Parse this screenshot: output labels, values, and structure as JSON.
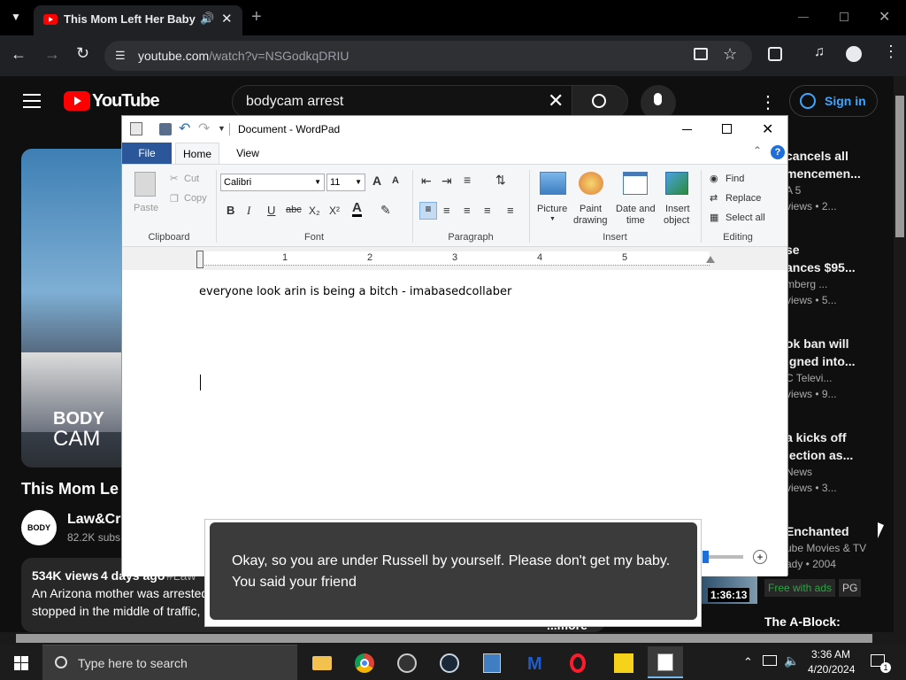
{
  "browser": {
    "tab_title": "This Mom Left Her Baby H",
    "url_host": "youtube.com",
    "url_path": "/watch?v=NSGodkqDRIU"
  },
  "youtube": {
    "logo_text": "YouTube",
    "search_value": "bodycam arrest",
    "sign_in_label": "Sign in",
    "video_title": "This Mom Le",
    "player_overlay_top": "BODY",
    "player_overlay_bottom": "CAM",
    "channel_name": "Law&Cri",
    "subscribers": "82.2K subs",
    "views": "534K views",
    "age": "4 days ago",
    "hashtag": "#Law",
    "description_line1": "An Arizona mother was arrested",
    "description_line2": "stopped in the middle of traffic,",
    "more_label": "...more",
    "duration_badge": "1:36:13",
    "recommendations": [
      {
        "title1": "cancels all",
        "title2": "mencemen...",
        "channel": "A 5",
        "meta": "views • 2..."
      },
      {
        "title1": "se",
        "title2": "ances $95...",
        "channel": "mberg ...",
        "meta": "views • 5..."
      },
      {
        "title1": "ok ban will",
        "title2": "igned into...",
        "channel": "C Televi...",
        "meta": "views • 9..."
      },
      {
        "title1": "a kicks off",
        "title2": "lection as...",
        "channel": "News",
        "meta": "views • 3..."
      },
      {
        "title1": "Enchanted",
        "title2": "",
        "channel": "ube Movies & TV",
        "meta": "ady • 2004"
      }
    ],
    "free_with_ads": "Free with ads",
    "rating": "PG",
    "next_title": "The A-Block:"
  },
  "wordpad": {
    "title": "Document - WordPad",
    "tabs": [
      "File",
      "Home",
      "View"
    ],
    "clipboard": {
      "paste": "Paste",
      "cut": "Cut",
      "copy": "Copy",
      "label": "Clipboard"
    },
    "font": {
      "family": "Calibri",
      "size": "11",
      "label": "Font"
    },
    "paragraph_label": "Paragraph",
    "insert": {
      "picture": "Picture",
      "paint1": "Paint",
      "paint2": "drawing",
      "date1": "Date and",
      "date2": "time",
      "obj1": "Insert",
      "obj2": "object",
      "label": "Insert"
    },
    "editing": {
      "find": "Find",
      "replace": "Replace",
      "select_all": "Select all",
      "label": "Editing"
    },
    "ruler_numbers": [
      "1",
      "2",
      "3",
      "4",
      "5"
    ],
    "document_text": "everyone look arin is being a bitch - imabasedcollaber"
  },
  "caption": {
    "line1": "Okay, so you are under Russell by yourself. Please don't get my baby.",
    "line2": "You said your friend"
  },
  "taskbar": {
    "search_placeholder": "Type here to search",
    "time": "3:36 AM",
    "date": "4/20/2024",
    "notification_count": "1"
  },
  "colors": {
    "accent_wordpad": "#2b579a",
    "youtube_red": "#ff0000",
    "sign_in": "#3ea6ff"
  }
}
